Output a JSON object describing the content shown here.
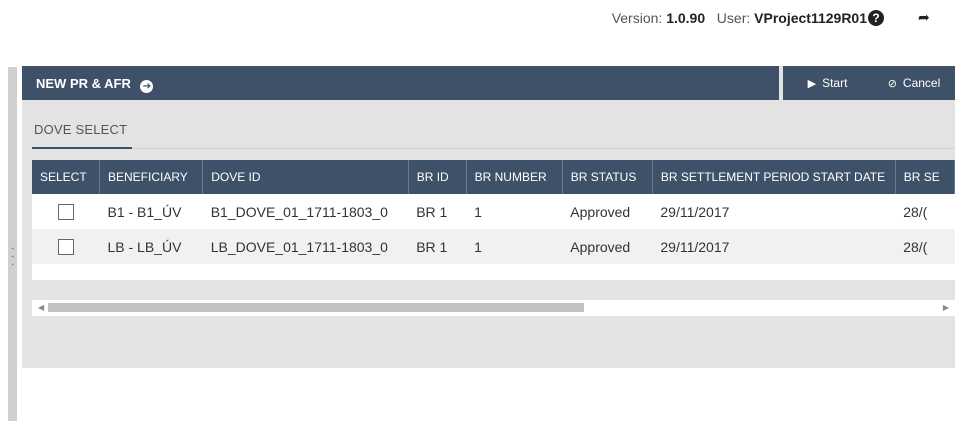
{
  "topbar": {
    "version_label": "Version:",
    "version_value": "1.0.90",
    "user_label": "User:",
    "user_value": "VProject1129R01",
    "help_glyph": "?",
    "logout_glyph": "➦"
  },
  "panel": {
    "title": "NEW PR & AFR",
    "title_arrow": "➔",
    "start_label": "Start",
    "cancel_label": "Cancel"
  },
  "tab": {
    "label": "DOVE SELECT"
  },
  "table": {
    "headers": [
      "SELECT",
      "BENEFICIARY",
      "DOVE ID",
      "BR ID",
      "BR NUMBER",
      "BR STATUS",
      "BR SETTLEMENT PERIOD START DATE",
      "BR SE"
    ],
    "rows": [
      {
        "beneficiary": "B1 - B1_ÚV",
        "dove_id": "B1_DOVE_01_1711-1803_0",
        "br_id": "BR 1",
        "br_number": "1",
        "br_status": "Approved",
        "start_date": "29/11/2017",
        "end_date": "28/("
      },
      {
        "beneficiary": "LB - LB_ÚV",
        "dove_id": "LB_DOVE_01_1711-1803_0",
        "br_id": "BR 1",
        "br_number": "1",
        "br_status": "Approved",
        "start_date": "29/11/2017",
        "end_date": "28/("
      }
    ]
  },
  "colors": {
    "header_bg": "#3f5168",
    "panel_bg": "#e3e3e3"
  }
}
